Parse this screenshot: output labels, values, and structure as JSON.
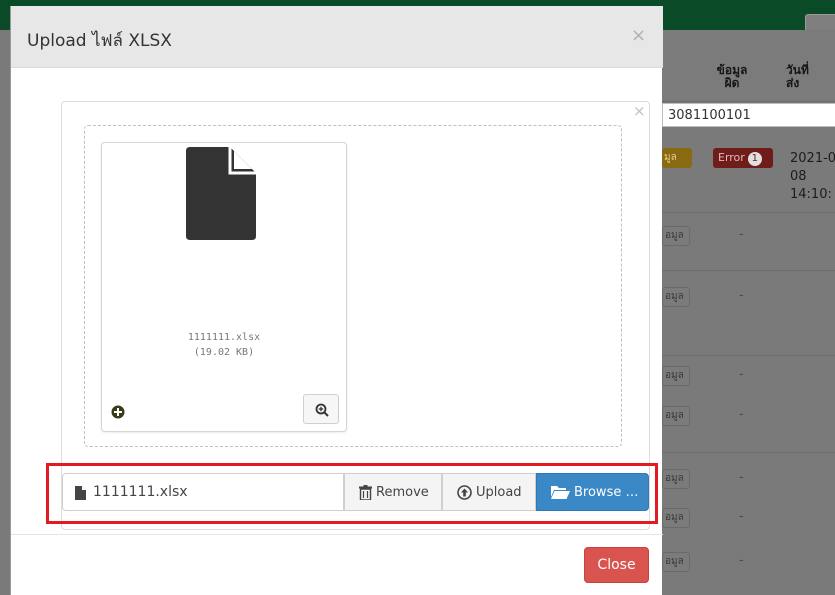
{
  "background": {
    "columns": [
      "ข้อมูล\nผิด",
      "วันที่\nส่ง"
    ],
    "search_value": "3081100101",
    "row_button_label": "อมูล",
    "badge_label": "มูล",
    "error_label": "Error",
    "error_count": "1",
    "date_text": "2021-0\n08\n14:10:",
    "dash": "-"
  },
  "modal": {
    "title": "Upload ไฟล์ XLSX",
    "close_symbol": "×",
    "panel_close_symbol": "×",
    "preview": {
      "file_name": "1111111.xlsx",
      "file_size": "(19.02 KB)",
      "icons": {
        "file": "file-icon",
        "plus": "plus-circle-icon",
        "zoom": "zoom-in-icon"
      }
    },
    "file_input": {
      "caption": "1111111.xlsx",
      "remove_label": "Remove",
      "upload_label": "Upload",
      "browse_label": "Browse …",
      "icons": {
        "caption": "file-icon",
        "remove": "trash-icon",
        "upload": "upload-circle-icon",
        "browse": "folder-open-icon"
      }
    },
    "close_button": "Close"
  },
  "colors": {
    "highlight": "#e21b23",
    "browse": "#3a88c5",
    "close": "#d9534f",
    "topbar": "#0b4a27"
  }
}
